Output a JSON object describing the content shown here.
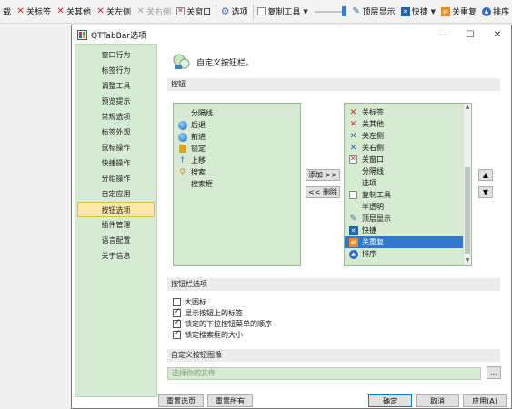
{
  "toolbar": {
    "items": [
      {
        "label": "载",
        "icon": "none"
      },
      {
        "label": "关标签",
        "icon": "close-red"
      },
      {
        "label": "关其他",
        "icon": "close-red"
      },
      {
        "label": "关左侧",
        "icon": "close-red"
      },
      {
        "label": "关右侧",
        "icon": "close-grey",
        "disabled": true
      },
      {
        "label": "关窗口",
        "icon": "close-box"
      },
      {
        "label": "选项",
        "icon": "gear"
      },
      {
        "label": "复制工具",
        "icon": "copy"
      },
      {
        "label": "顶层显示",
        "icon": "pin"
      },
      {
        "label": "快捷",
        "icon": "shortcut"
      },
      {
        "label": "关重复",
        "icon": "dup"
      },
      {
        "label": "排序",
        "icon": "sort"
      }
    ]
  },
  "window": {
    "title": "QTTabBar选项",
    "controls": {
      "minimize": "—",
      "maximize": "☐",
      "close": "✕"
    }
  },
  "sidebar": {
    "items": [
      {
        "label": "窗口行为"
      },
      {
        "label": "标签行为"
      },
      {
        "label": "调整工具"
      },
      {
        "label": "预览提示"
      },
      {
        "label": "常规选项"
      },
      {
        "label": "标签外观"
      },
      {
        "label": "鼠标操作"
      },
      {
        "label": "快捷操作"
      },
      {
        "label": "分组操作"
      },
      {
        "label": "自定应用"
      },
      {
        "label": "按钮选项",
        "selected": true
      },
      {
        "label": "插件管理"
      },
      {
        "label": "语言配置"
      },
      {
        "label": "关于信息"
      }
    ]
  },
  "main": {
    "header_title": "自定义按钮栏。",
    "buttons_section": "按钮",
    "available": [
      {
        "label": "分隔线",
        "icon": "none"
      },
      {
        "label": "后退",
        "icon": "globe"
      },
      {
        "label": "前进",
        "icon": "globe"
      },
      {
        "label": "锁定",
        "icon": "lock"
      },
      {
        "label": "上移",
        "icon": "arrow-up"
      },
      {
        "label": "搜索",
        "icon": "search"
      },
      {
        "label": "搜索框",
        "icon": "none"
      }
    ],
    "selected": [
      {
        "label": "关标签",
        "icon": "x-red"
      },
      {
        "label": "关其他",
        "icon": "x-red"
      },
      {
        "label": "关左侧",
        "icon": "x-blue"
      },
      {
        "label": "关右侧",
        "icon": "x-blue"
      },
      {
        "label": "关窗口",
        "icon": "x-box"
      },
      {
        "label": "分隔线",
        "icon": "none"
      },
      {
        "label": "选项",
        "icon": "none"
      },
      {
        "label": "复制工具",
        "icon": "copy"
      },
      {
        "label": "半透明",
        "icon": "none"
      },
      {
        "label": "顶层显示",
        "icon": "pin"
      },
      {
        "label": "快捷",
        "icon": "shortcut"
      },
      {
        "label": "关重复",
        "icon": "dup",
        "selected": true
      },
      {
        "label": "排序",
        "icon": "sort"
      }
    ],
    "add_button": "添加 >>",
    "remove_button": "<< 删除",
    "up_button": "▲",
    "down_button": "▼",
    "toolbar_options_section": "按钮栏选项",
    "options": [
      {
        "label": "大图标",
        "checked": false
      },
      {
        "label": "显示按钮上的标签",
        "checked": true
      },
      {
        "label": "锁定的下拉按钮菜单的顺序",
        "checked": true
      },
      {
        "label": "锁定搜索框的大小",
        "checked": true
      }
    ],
    "custom_image_section": "自定义按钮图像",
    "file_placeholder": "选择你的文件",
    "browse_button": "..."
  },
  "footer": {
    "reset_page": "重置选页",
    "reset_all": "重置所有",
    "ok": "确定",
    "cancel": "取消",
    "apply": "应用(A)"
  }
}
